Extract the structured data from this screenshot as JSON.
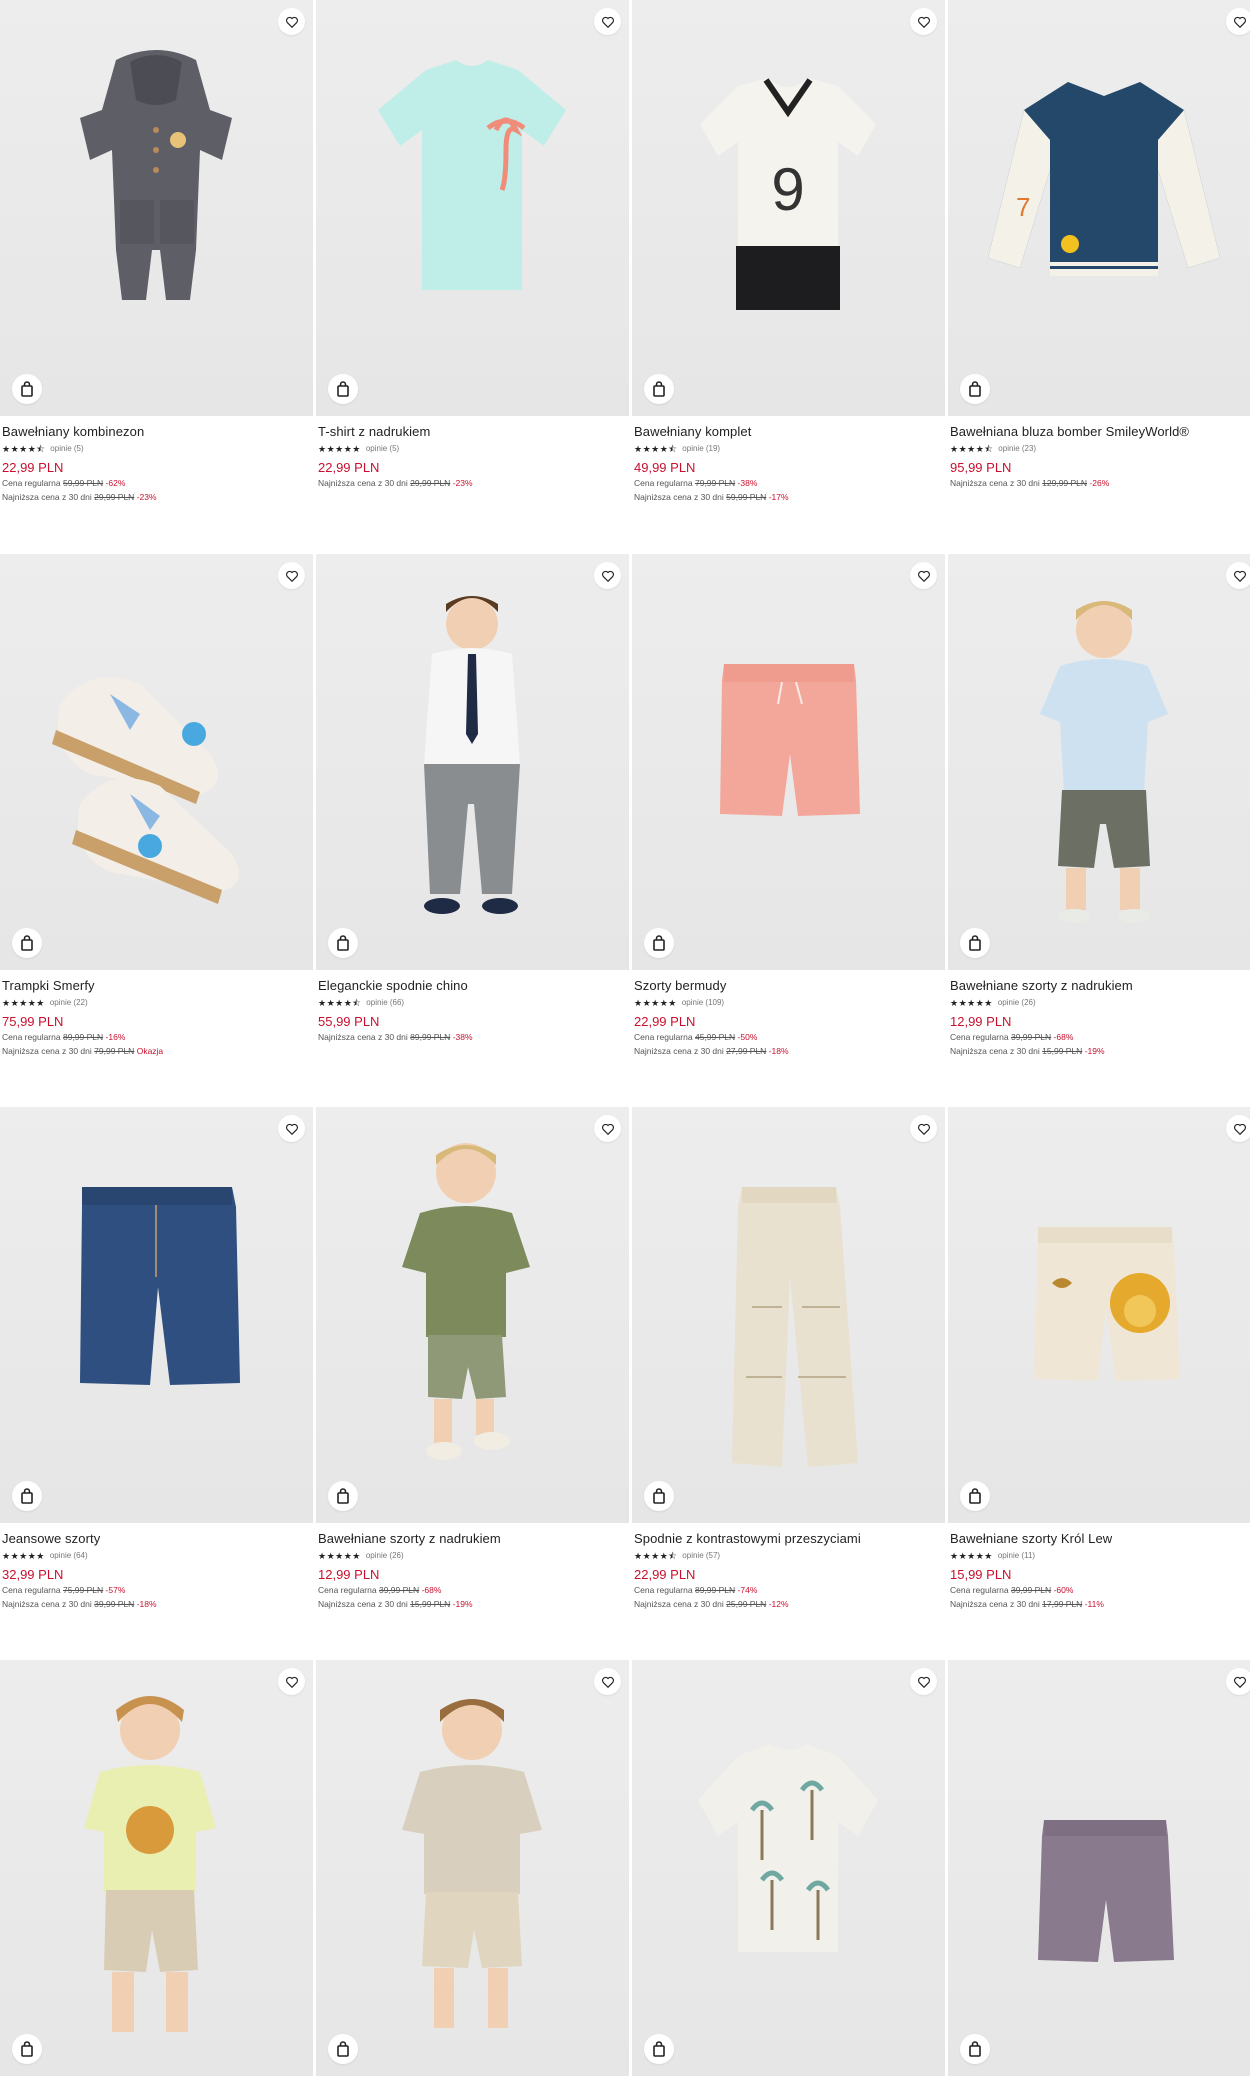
{
  "products": [
    {
      "name": "Bawełniany kombinezon",
      "stars": "★★★★⯪",
      "reviews": "opinie (5)",
      "price": "22,99 PLN",
      "regular_label": "Cena regularna",
      "regular_price": "59,99 PLN",
      "regular_pct": "-62%",
      "lowest_label": "Najniższa cena z 30 dni",
      "lowest_price": "29,99 PLN",
      "lowest_pct": "-23%"
    },
    {
      "name": "T-shirt z nadrukiem",
      "stars": "★★★★★",
      "reviews": "opinie (5)",
      "price": "22,99 PLN",
      "regular_label": "",
      "regular_price": "",
      "regular_pct": "",
      "lowest_label": "Najniższa cena z 30 dni",
      "lowest_price": "29,99 PLN",
      "lowest_pct": "-23%"
    },
    {
      "name": "Bawełniany komplet",
      "stars": "★★★★⯪",
      "reviews": "opinie (19)",
      "price": "49,99 PLN",
      "regular_label": "Cena regularna",
      "regular_price": "79,99 PLN",
      "regular_pct": "-38%",
      "lowest_label": "Najniższa cena z 30 dni",
      "lowest_price": "59,99 PLN",
      "lowest_pct": "-17%"
    },
    {
      "name": "Bawełniana bluza bomber SmileyWorld®",
      "stars": "★★★★⯪",
      "reviews": "opinie (23)",
      "price": "95,99 PLN",
      "regular_label": "",
      "regular_price": "",
      "regular_pct": "",
      "lowest_label": "Najniższa cena z 30 dni",
      "lowest_price": "129,99 PLN",
      "lowest_pct": "-26%"
    },
    {
      "name": "Trampki Smerfy",
      "stars": "★★★★★",
      "reviews": "opinie (22)",
      "price": "75,99 PLN",
      "regular_label": "Cena regularna",
      "regular_price": "89,99 PLN",
      "regular_pct": "-16%",
      "lowest_label": "Najniższa cena z 30 dni",
      "lowest_price": "79,99 PLN",
      "lowest_pct": "Okazja"
    },
    {
      "name": "Eleganckie spodnie chino",
      "stars": "★★★★⯪",
      "reviews": "opinie (66)",
      "price": "55,99 PLN",
      "regular_label": "",
      "regular_price": "",
      "regular_pct": "",
      "lowest_label": "Najniższa cena z 30 dni",
      "lowest_price": "89,99 PLN",
      "lowest_pct": "-38%"
    },
    {
      "name": "Szorty bermudy",
      "stars": "★★★★★",
      "reviews": "opinie (109)",
      "price": "22,99 PLN",
      "regular_label": "Cena regularna",
      "regular_price": "45,99 PLN",
      "regular_pct": "-50%",
      "lowest_label": "Najniższa cena z 30 dni",
      "lowest_price": "27,99 PLN",
      "lowest_pct": "-18%"
    },
    {
      "name": "Bawełniane szorty z nadrukiem",
      "stars": "★★★★★",
      "reviews": "opinie (26)",
      "price": "12,99 PLN",
      "regular_label": "Cena regularna",
      "regular_price": "39,99 PLN",
      "regular_pct": "-68%",
      "lowest_label": "Najniższa cena z 30 dni",
      "lowest_price": "15,99 PLN",
      "lowest_pct": "-19%"
    },
    {
      "name": "Jeansowe szorty",
      "stars": "★★★★★",
      "reviews": "opinie (64)",
      "price": "32,99 PLN",
      "regular_label": "Cena regularna",
      "regular_price": "75,99 PLN",
      "regular_pct": "-57%",
      "lowest_label": "Najniższa cena z 30 dni",
      "lowest_price": "39,99 PLN",
      "lowest_pct": "-18%"
    },
    {
      "name": "Bawełniane szorty z nadrukiem",
      "stars": "★★★★★",
      "reviews": "opinie (26)",
      "price": "12,99 PLN",
      "regular_label": "Cena regularna",
      "regular_price": "39,99 PLN",
      "regular_pct": "-68%",
      "lowest_label": "Najniższa cena z 30 dni",
      "lowest_price": "15,99 PLN",
      "lowest_pct": "-19%"
    },
    {
      "name": "Spodnie z kontrastowymi przeszyciami",
      "stars": "★★★★⯪",
      "reviews": "opinie (57)",
      "price": "22,99 PLN",
      "regular_label": "Cena regularna",
      "regular_price": "89,99 PLN",
      "regular_pct": "-74%",
      "lowest_label": "Najniższa cena z 30 dni",
      "lowest_price": "25,99 PLN",
      "lowest_pct": "-12%"
    },
    {
      "name": "Bawełniane szorty Król Lew",
      "stars": "★★★★★",
      "reviews": "opinie (11)",
      "price": "15,99 PLN",
      "regular_label": "Cena regularna",
      "regular_price": "39,99 PLN",
      "regular_pct": "-60%",
      "lowest_label": "Najniższa cena z 30 dni",
      "lowest_price": "17,99 PLN",
      "lowest_pct": "-11%"
    },
    {
      "name": "",
      "stars": "",
      "reviews": "",
      "price": "",
      "regular_label": "",
      "regular_price": "",
      "regular_pct": "",
      "lowest_label": "",
      "lowest_price": "",
      "lowest_pct": ""
    },
    {
      "name": "",
      "stars": "",
      "reviews": "",
      "price": "",
      "regular_label": "",
      "regular_price": "",
      "regular_pct": "",
      "lowest_label": "",
      "lowest_price": "",
      "lowest_pct": ""
    },
    {
      "name": "",
      "stars": "",
      "reviews": "",
      "price": "",
      "regular_label": "",
      "regular_price": "",
      "regular_pct": "",
      "lowest_label": "",
      "lowest_price": "",
      "lowest_pct": ""
    },
    {
      "name": "",
      "stars": "",
      "reviews": "",
      "price": "",
      "regular_label": "",
      "regular_price": "",
      "regular_pct": "",
      "lowest_label": "",
      "lowest_price": "",
      "lowest_pct": ""
    }
  ],
  "images": [
    {
      "icon": "romper-icon",
      "color": "#5e5f66"
    },
    {
      "icon": "tshirt-icon",
      "color": "#bfeee9"
    },
    {
      "icon": "tshirt-set-icon",
      "color": "#f5f3ee"
    },
    {
      "icon": "bomber-jacket-icon",
      "color": "#23486a"
    },
    {
      "icon": "sneakers-icon",
      "color": "#f3efe8"
    },
    {
      "icon": "boy-shirt-tie-icon",
      "color": "#f6f6f6"
    },
    {
      "icon": "shorts-icon",
      "color": "#f3a79a"
    },
    {
      "icon": "boy-polo-icon",
      "color": "#cde1f0"
    },
    {
      "icon": "denim-shorts-icon",
      "color": "#2e4f7f"
    },
    {
      "icon": "boy-green-tshirt-icon",
      "color": "#7d8b5c"
    },
    {
      "icon": "trousers-icon",
      "color": "#e9e1cf"
    },
    {
      "icon": "lion-shorts-icon",
      "color": "#efe6d6"
    },
    {
      "icon": "boy-lion-tshirt-icon",
      "color": "#e9efb0"
    },
    {
      "icon": "boy-beige-tshirt-icon",
      "color": "#d9cfbf"
    },
    {
      "icon": "printed-shirt-icon",
      "color": "#f2f0ea"
    },
    {
      "icon": "purple-shorts-icon",
      "color": "#8a7a8d"
    }
  ]
}
